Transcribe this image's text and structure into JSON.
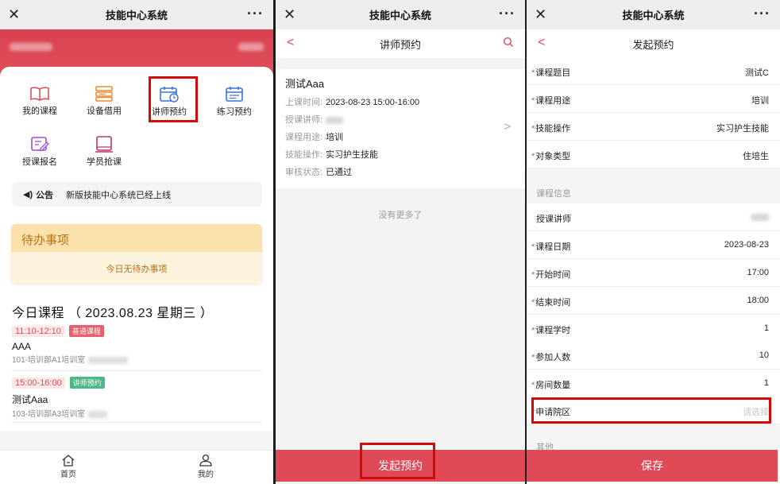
{
  "panel1": {
    "title": "技能中心系统",
    "close_icon": "close-icon",
    "more_icon": "more-icon",
    "tiles": [
      {
        "label": "我的课程",
        "icon": "book-icon",
        "color": "#e0505d"
      },
      {
        "label": "设备借用",
        "icon": "server-icon",
        "color": "#f08b36"
      },
      {
        "label": "讲师预约",
        "icon": "calendar-clock-icon",
        "color": "#3f6fe0"
      },
      {
        "label": "练习预约",
        "icon": "calendar-icon",
        "color": "#3f6fe0"
      },
      {
        "label": "授课报名",
        "icon": "edit-icon",
        "color": "#a64ad8"
      },
      {
        "label": "学员抢课",
        "icon": "tablet-icon",
        "color": "#c2306d"
      }
    ],
    "notice": {
      "label": "公告",
      "text": "新版技能中心系统已经上线"
    },
    "todo": {
      "title": "待办事项",
      "empty": "今日无待办事项"
    },
    "today_title": "今日课程 （ 2023.08.23 星期三 ）",
    "courses": [
      {
        "time": "11:10-12:10",
        "tag": "普通课程",
        "tag_color": "#e8606b",
        "name": "AAA",
        "location": "101-培训部A1培训室"
      },
      {
        "time": "15:00-16:00",
        "tag": "讲师预约",
        "tag_color": "#4cb884",
        "name": "测试Aaa",
        "location": "103-培训部A3培训室"
      }
    ],
    "tabs": [
      {
        "label": "首页",
        "icon": "home-icon"
      },
      {
        "label": "我的",
        "icon": "user-icon"
      }
    ]
  },
  "panel2": {
    "title": "技能中心系统",
    "nav_title": "讲师预约",
    "record": {
      "title": "测试Aaa",
      "rows": [
        {
          "key": "上课时间:",
          "value": "2023-08-23 15:00-16:00"
        },
        {
          "key": "授课讲师:",
          "value": ""
        },
        {
          "key": "课程用途:",
          "value": "培训"
        },
        {
          "key": "技能操作:",
          "value": "实习护生技能"
        },
        {
          "key": "审核状态:",
          "value": "已通过"
        }
      ]
    },
    "no_more": "没有更多了",
    "button": "发起预约"
  },
  "panel3": {
    "title": "技能中心系统",
    "nav_title": "发起预约",
    "group1": [
      {
        "label": "课程题目",
        "value": "测试C",
        "required": true
      },
      {
        "label": "课程用途",
        "value": "培训",
        "required": true
      },
      {
        "label": "技能操作",
        "value": "实习护生技能",
        "required": true
      },
      {
        "label": "对象类型",
        "value": "住培生",
        "required": true
      }
    ],
    "section_course": "课程信息",
    "group2": [
      {
        "label": "授课讲师",
        "value": "",
        "required": false
      },
      {
        "label": "课程日期",
        "value": "2023-08-23",
        "required": true
      },
      {
        "label": "开始时间",
        "value": "17:00",
        "required": true
      },
      {
        "label": "结束时间",
        "value": "18:00",
        "required": true
      },
      {
        "label": "课程学时",
        "value": "1",
        "required": true
      },
      {
        "label": "参加人数",
        "value": "10",
        "required": true
      },
      {
        "label": "房间数量",
        "value": "1",
        "required": true
      },
      {
        "label": "申请院区",
        "value": "请选择",
        "required": true,
        "placeholder": true
      }
    ],
    "section_other": "其他",
    "button": "保存"
  },
  "accent": "#e04a57",
  "highlight": "#d10a0a"
}
